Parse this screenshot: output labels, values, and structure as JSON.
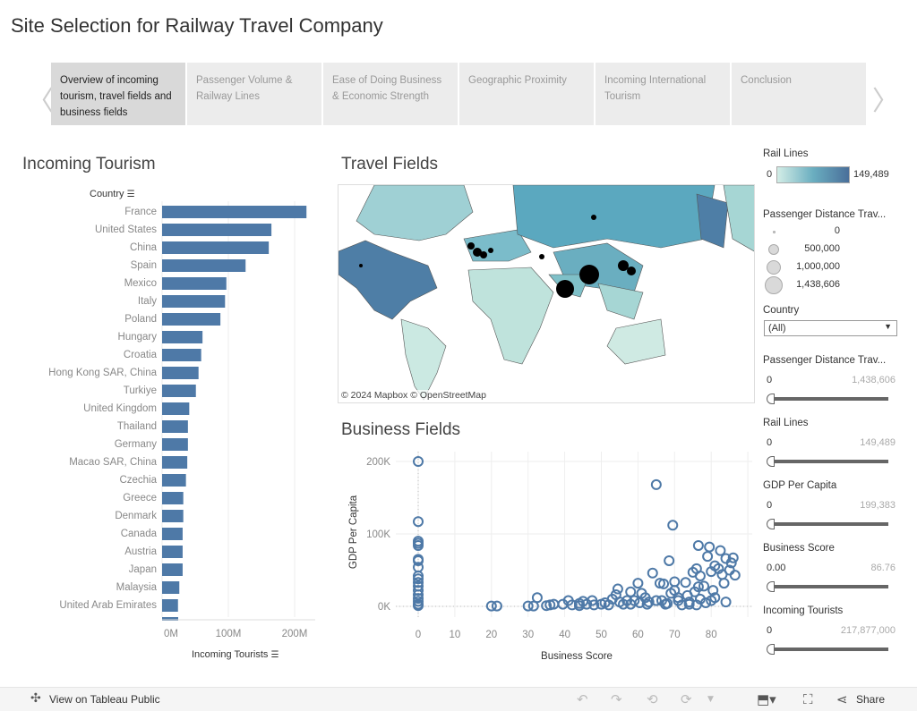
{
  "title": "Site Selection for Railway Travel Company",
  "tabs": [
    {
      "label": "Overview of incoming tourism, travel fields and business fields",
      "active": true
    },
    {
      "label": "Passenger Volume & Railway Lines",
      "active": false
    },
    {
      "label": "Ease of Doing Business & Economic Strength",
      "active": false
    },
    {
      "label": "Geographic Proximity",
      "active": false
    },
    {
      "label": "Incoming International Tourism",
      "active": false
    },
    {
      "label": "Conclusion",
      "active": false
    }
  ],
  "nav": {
    "prev_icon": "chevron-left-icon",
    "next_icon": "chevron-right-icon"
  },
  "incoming_tourism": {
    "heading": "Incoming Tourism",
    "country_header": "Country",
    "axis_title": "Incoming Tourists",
    "ticks": [
      "0M",
      "100M",
      "200M"
    ]
  },
  "travel_fields": {
    "heading": "Travel Fields",
    "attribution": "© 2024 Mapbox  © OpenStreetMap"
  },
  "business_fields": {
    "heading": "Business Fields",
    "x_title": "Business Score",
    "y_title": "GDP Per Capita",
    "x_ticks": [
      "0",
      "10",
      "20",
      "30",
      "40",
      "50",
      "60",
      "70",
      "80"
    ],
    "y_ticks": [
      "200K",
      "100K",
      "0K"
    ]
  },
  "chart_data": [
    {
      "type": "bar",
      "orientation": "horizontal",
      "xlabel": "Incoming Tourists",
      "ylabel": "Country",
      "xlim": [
        0,
        230000000
      ],
      "color": "#4e79a7",
      "categories": [
        "France",
        "United States",
        "China",
        "Spain",
        "Mexico",
        "Italy",
        "Poland",
        "Hungary",
        "Croatia",
        "Hong Kong SAR, China",
        "Turkiye",
        "United Kingdom",
        "Thailand",
        "Germany",
        "Macao SAR, China",
        "Czechia",
        "Greece",
        "Denmark",
        "Canada",
        "Austria",
        "Japan",
        "Malaysia",
        "United Arab Emirates"
      ],
      "values": [
        217877000,
        165000000,
        161000000,
        126000000,
        97000000,
        95000000,
        88000000,
        61000000,
        59000000,
        55000000,
        51000000,
        41000000,
        39000000,
        39000000,
        38000000,
        36000000,
        32000000,
        32000000,
        31000000,
        31000000,
        31000000,
        26000000,
        24000000
      ]
    },
    {
      "type": "scatter",
      "xlabel": "Business Score",
      "ylabel": "GDP Per Capita",
      "xlim": [
        -5,
        90
      ],
      "ylim": [
        -15000,
        210000
      ],
      "color": "#4e79a7",
      "marker": "hollow-circle",
      "points": [
        [
          0,
          200000
        ],
        [
          0,
          117000
        ],
        [
          0,
          90000
        ],
        [
          0,
          87000
        ],
        [
          0,
          84000
        ],
        [
          0,
          65000
        ],
        [
          0,
          63000
        ],
        [
          0,
          54000
        ],
        [
          0,
          42000
        ],
        [
          0,
          38000
        ],
        [
          0,
          33000
        ],
        [
          0,
          28000
        ],
        [
          0,
          22000
        ],
        [
          0,
          16000
        ],
        [
          0,
          11000
        ],
        [
          0,
          7000
        ],
        [
          0,
          3000
        ],
        [
          0,
          1000
        ],
        [
          20,
          500
        ],
        [
          21.5,
          500
        ],
        [
          30,
          500
        ],
        [
          31.5,
          500
        ],
        [
          32.5,
          12000
        ],
        [
          35,
          1000
        ],
        [
          36,
          2000
        ],
        [
          37,
          3000
        ],
        [
          39.5,
          3000
        ],
        [
          41,
          8000
        ],
        [
          42,
          2000
        ],
        [
          44,
          1000
        ],
        [
          44,
          4000
        ],
        [
          45,
          7000
        ],
        [
          46,
          3000
        ],
        [
          47.5,
          8000
        ],
        [
          48,
          2000
        ],
        [
          50,
          3000
        ],
        [
          51,
          5000
        ],
        [
          52,
          2000
        ],
        [
          53,
          10000
        ],
        [
          54,
          16000
        ],
        [
          54.5,
          24000
        ],
        [
          55,
          6000
        ],
        [
          56,
          3000
        ],
        [
          57,
          8000
        ],
        [
          58,
          20000
        ],
        [
          58,
          3000
        ],
        [
          59,
          8000
        ],
        [
          60,
          32000
        ],
        [
          60.5,
          5000
        ],
        [
          61,
          18000
        ],
        [
          62,
          12000
        ],
        [
          62.5,
          3000
        ],
        [
          63,
          6000
        ],
        [
          64,
          46000
        ],
        [
          65,
          168000
        ],
        [
          65,
          8000
        ],
        [
          66,
          32000
        ],
        [
          66.5,
          8000
        ],
        [
          67,
          31000
        ],
        [
          67.5,
          3000
        ],
        [
          68,
          4000
        ],
        [
          68.5,
          63000
        ],
        [
          69,
          18000
        ],
        [
          69.5,
          112000
        ],
        [
          70,
          34000
        ],
        [
          70,
          22000
        ],
        [
          71,
          8000
        ],
        [
          71,
          12000
        ],
        [
          72,
          2000
        ],
        [
          73,
          33000
        ],
        [
          73.5,
          15000
        ],
        [
          74,
          6000
        ],
        [
          74,
          3000
        ],
        [
          75,
          47000
        ],
        [
          75.5,
          20000
        ],
        [
          76,
          52000
        ],
        [
          76,
          2000
        ],
        [
          76.5,
          84000
        ],
        [
          76.5,
          27000
        ],
        [
          77,
          42000
        ],
        [
          77,
          10000
        ],
        [
          78,
          28000
        ],
        [
          78.5,
          5000
        ],
        [
          79,
          69000
        ],
        [
          79.5,
          82000
        ],
        [
          80,
          48000
        ],
        [
          80,
          8000
        ],
        [
          80.5,
          22000
        ],
        [
          81,
          56000
        ],
        [
          81,
          12000
        ],
        [
          82,
          52000
        ],
        [
          82.5,
          77000
        ],
        [
          83,
          44000
        ],
        [
          83.5,
          32000
        ],
        [
          84,
          66000
        ],
        [
          84,
          6000
        ],
        [
          85,
          50000
        ],
        [
          85.5,
          60000
        ],
        [
          86,
          67000
        ],
        [
          86.5,
          43000
        ]
      ]
    }
  ],
  "legend_rail_lines": {
    "title": "Rail Lines",
    "min": "0",
    "max": "149,489",
    "colors": [
      "#d3ede6",
      "#6aaec0",
      "#4a6f9a"
    ]
  },
  "legend_passenger": {
    "title": "Passenger Distance Trav...",
    "entries": [
      "0",
      "500,000",
      "1,000,000",
      "1,438,606"
    ]
  },
  "filter_country": {
    "title": "Country",
    "value": "(All)"
  },
  "sliders": [
    {
      "title": "Passenger Distance Trav...",
      "min": "0",
      "max": "1,438,606",
      "level": 0
    },
    {
      "title": "Rail Lines",
      "min": "0",
      "max": "149,489",
      "level": 0
    },
    {
      "title": "GDP Per Capita",
      "min": "0",
      "max": "199,383",
      "level": 0
    },
    {
      "title": "Business Score",
      "min": "0.00",
      "max": "86.76",
      "level": 0
    },
    {
      "title": "Incoming Tourists",
      "min": "0",
      "max": "217,877,000",
      "level": 0
    }
  ],
  "footer": {
    "view_label": "View on Tableau Public",
    "share_label": "Share"
  }
}
